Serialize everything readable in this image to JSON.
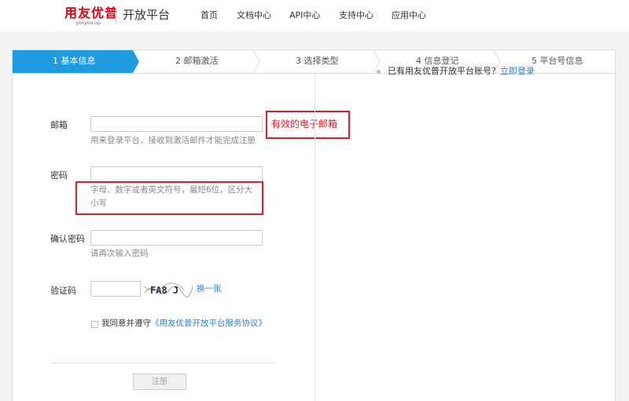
{
  "header": {
    "logo": "用友优普",
    "logo_sub": "yonyou up",
    "platform": "开放平台",
    "nav": [
      "首页",
      "文档中心",
      "API中心",
      "支持中心",
      "应用中心"
    ]
  },
  "steps": [
    {
      "label": "1 基本信息",
      "active": true
    },
    {
      "label": "2 邮箱激活",
      "active": false
    },
    {
      "label": "3 选择类型",
      "active": false
    },
    {
      "label": "4 信息登记",
      "active": false
    },
    {
      "label": "5 平台号信息",
      "active": false
    }
  ],
  "form": {
    "email": {
      "label": "邮箱",
      "value": "",
      "hint": "用来登录平台，接收到激活邮件才能完成注册"
    },
    "password": {
      "label": "密码",
      "value": "",
      "hint_line1": "字母、数字或者英文符号，最短6位，区分大",
      "hint_line2": "小写"
    },
    "confirm": {
      "label": "确认密码",
      "value": "",
      "hint": "请再次输入密码"
    },
    "captcha": {
      "label": "验证码",
      "value": "",
      "image_text": "FA8 J",
      "refresh": "换一张"
    },
    "agree_text": "我同意并遵守",
    "agree_link": "《用友优普开放平台服务协议》",
    "submit": "注册"
  },
  "annotation": {
    "email_note": "有效的电子邮箱"
  },
  "side": {
    "text": "已有用友优普开放平台账号？",
    "link": "立即登录"
  },
  "colors": {
    "active_step": "#1f9bdf",
    "annotation": "#d9202a",
    "link": "#2f7fc8",
    "brand": "#e60012"
  }
}
